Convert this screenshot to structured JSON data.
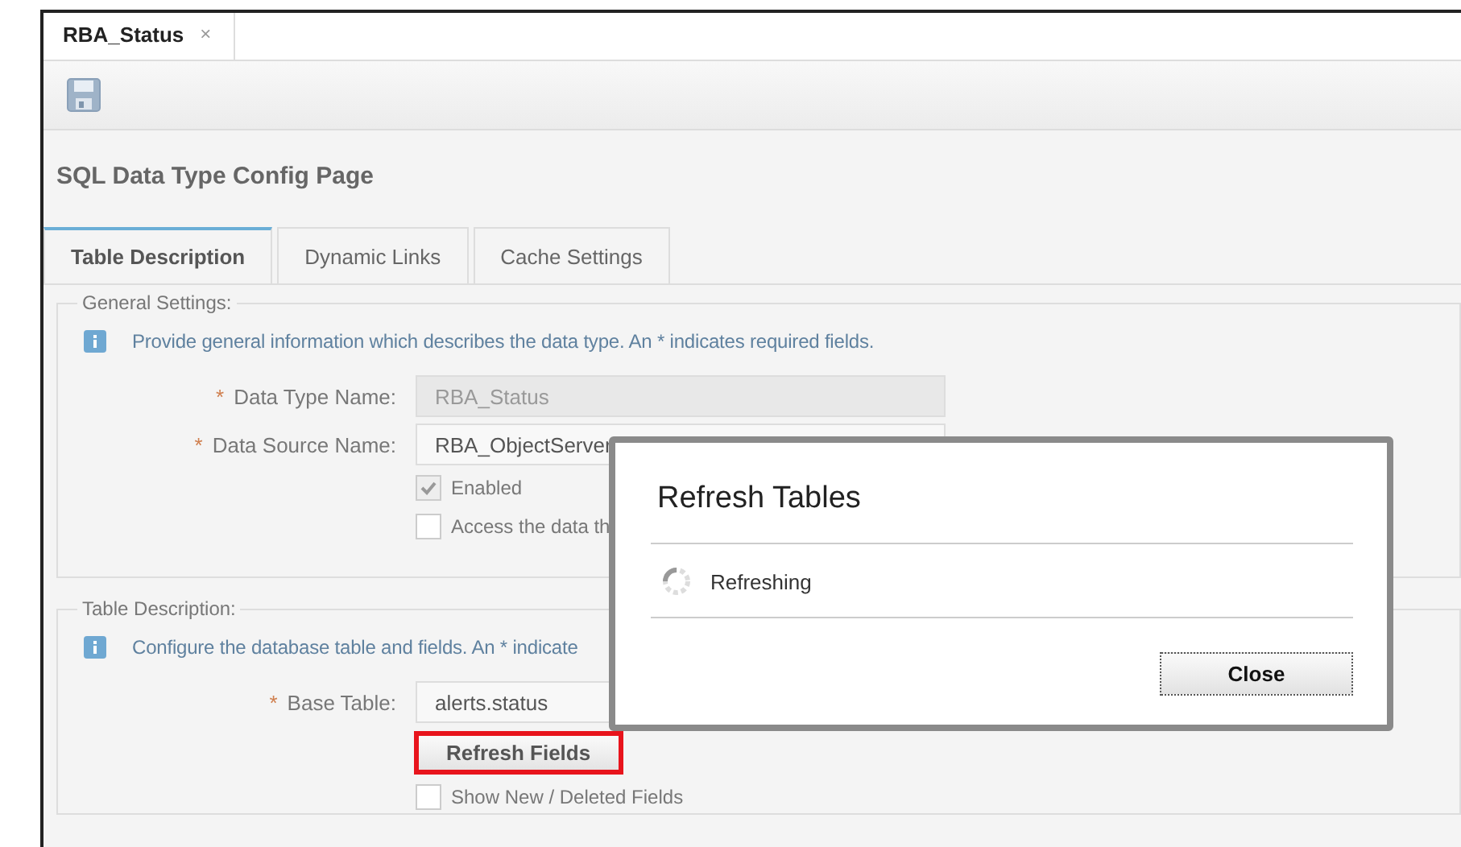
{
  "document_tab": {
    "label": "RBA_Status",
    "close": "×"
  },
  "page_title": "SQL Data Type Config Page",
  "tabs": [
    {
      "label": "Table Description",
      "selected": true
    },
    {
      "label": "Dynamic Links",
      "selected": false
    },
    {
      "label": "Cache Settings",
      "selected": false
    }
  ],
  "general_settings": {
    "legend": "General Settings:",
    "info": "Provide general information which describes the data type. An * indicates required fields.",
    "fields": [
      {
        "mark": "*",
        "label": "Data Type Name:",
        "value": "RBA_Status",
        "disabled": true
      },
      {
        "mark": "*",
        "label": "Data Source Name:",
        "value": "RBA_ObjectServer",
        "disabled": false
      }
    ],
    "checkboxes": [
      {
        "label": "Enabled",
        "checked": true,
        "disabled": true
      },
      {
        "label": "Access the data th",
        "checked": false,
        "disabled": false
      }
    ]
  },
  "table_description": {
    "legend": "Table Description:",
    "info": "Configure the database table and fields. An * indicate",
    "fields": [
      {
        "mark": "*",
        "label": "Base Table:",
        "value": "alerts.status",
        "disabled": false
      }
    ],
    "button": {
      "label": "Refresh Fields",
      "highlighted": true
    },
    "checkboxes": [
      {
        "label": "Show New / Deleted Fields",
        "checked": false,
        "disabled": false
      }
    ]
  },
  "dialog": {
    "title": "Refresh Tables",
    "status": "Refreshing",
    "button": "Close"
  }
}
